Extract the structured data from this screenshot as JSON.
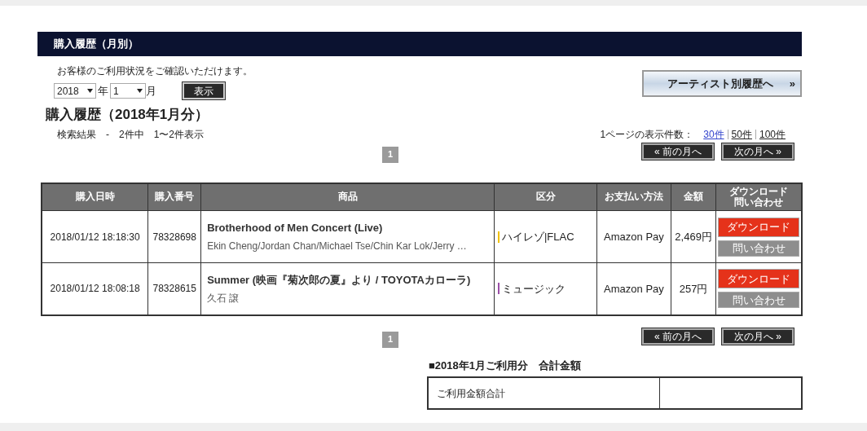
{
  "header": {
    "title": "購入履歴（月別）"
  },
  "intro": "お客様のご利用状況をご確認いただけます。",
  "filter": {
    "year": "2018",
    "year_unit": "年",
    "month": "1",
    "month_unit": "月",
    "submit": "表示"
  },
  "artist_link": {
    "label": "アーティスト別履歴へ",
    "arrow": "»"
  },
  "heading": "購入履歴（2018年1月分）",
  "result_summary": "検索結果　-　2件中　1〜2件表示",
  "per_page": {
    "label": "1ページの表示件数：",
    "options": [
      {
        "label": "30件",
        "selected": true
      },
      {
        "label": "50件",
        "selected": false
      },
      {
        "label": "100件",
        "selected": false
      }
    ]
  },
  "pagination_top": {
    "pages": [
      {
        "label": "1",
        "selected": true
      }
    ],
    "prev": "« 前の月へ",
    "next": "次の月へ »"
  },
  "table": {
    "columns": [
      "購入日時",
      "購入番号",
      "商品",
      "区分",
      "お支払い方法",
      "金額",
      [
        "ダウンロード",
        "問い合わせ"
      ]
    ],
    "rows": [
      {
        "date": "2018/01/12 18:18:30",
        "number": "78328698",
        "title": "Brotherhood of Men Concert (Live)",
        "artist": "Ekin Cheng/Jordan Chan/Michael Tse/Chin Kar Lok/Jerry …",
        "category": "ハイレゾ|FLAC",
        "color": "#f2c200",
        "payment": "Amazon Pay",
        "price": "2,469円",
        "download": "ダウンロード",
        "inquiry": "問い合わせ"
      },
      {
        "date": "2018/01/12 18:08:18",
        "number": "78328615",
        "title": "Summer (映画『菊次郎の夏』より / TOYOTAカローラ)",
        "artist": "久石 譲",
        "category": "ミュージック",
        "color": "#9b4fa8",
        "payment": "Amazon Pay",
        "price": "257円",
        "download": "ダウンロード",
        "inquiry": "問い合わせ"
      }
    ]
  },
  "pagination_bottom": {
    "pages": [
      {
        "label": "1",
        "selected": true
      }
    ],
    "prev": "« 前の月へ",
    "next": "次の月へ »"
  },
  "total": {
    "title": "■2018年1月ご利用分　合計金額",
    "label": "ご利用金額合計"
  }
}
